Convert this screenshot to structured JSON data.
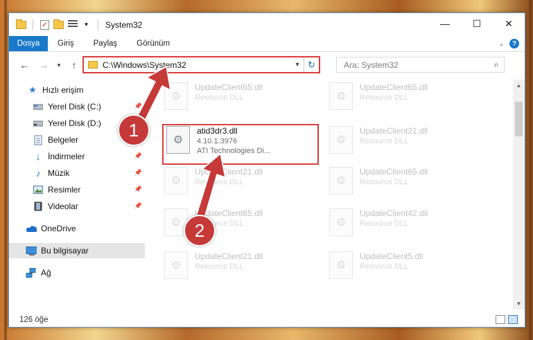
{
  "window": {
    "title": "System32",
    "controls": {
      "minimize": "—",
      "maximize": "☐",
      "close": "✕"
    }
  },
  "ribbon": {
    "tabs": [
      "Dosya",
      "Giriş",
      "Paylaş",
      "Görünüm"
    ],
    "help": "?"
  },
  "address": {
    "path": "C:\\Windows\\System32",
    "search_placeholder": "Ara: System32"
  },
  "nav": {
    "items": [
      {
        "label": "Hızlı erişim",
        "icon": "star-icon",
        "pinned": false
      },
      {
        "label": "Yerel Disk (C:)",
        "icon": "drive-c-icon",
        "pinned": true
      },
      {
        "label": "Yerel Disk (D:)",
        "icon": "drive-d-icon",
        "pinned": true
      },
      {
        "label": "Belgeler",
        "icon": "documents-icon",
        "pinned": true
      },
      {
        "label": "İndirmeler",
        "icon": "downloads-icon",
        "pinned": true
      },
      {
        "label": "Müzik",
        "icon": "music-icon",
        "pinned": true
      },
      {
        "label": "Resimler",
        "icon": "pictures-icon",
        "pinned": true
      },
      {
        "label": "Videolar",
        "icon": "videos-icon",
        "pinned": true
      },
      {
        "label": "OneDrive",
        "icon": "onedrive-icon",
        "pinned": false
      },
      {
        "label": "Bu bilgisayar",
        "icon": "this-pc-icon",
        "pinned": false
      },
      {
        "label": "Ağ",
        "icon": "network-icon",
        "pinned": false
      }
    ]
  },
  "files": {
    "highlighted": {
      "name": "atid3dr3.dll",
      "version": "4.10.1.3976",
      "company": "ATI Technologies Di..."
    },
    "faded": [
      {
        "name": "UpdateClient65.dll",
        "type": "Resource DLL"
      },
      {
        "name": "UpdateClient65.dll",
        "type": "Resource DLL"
      },
      {
        "name": "UpdateClient21.dll",
        "type": "Resource DLL"
      },
      {
        "name": "UpdateClient21.dll",
        "type": "Resource DLL"
      },
      {
        "name": "UpdateClient65.dll",
        "type": "Resource DLL"
      },
      {
        "name": "UpdateClient65.dll",
        "type": "Resource DLL"
      },
      {
        "name": "UpdateClient42.dll",
        "type": "Resource DLL"
      },
      {
        "name": "UpdateClient21.dll",
        "type": "Resource DLL"
      },
      {
        "name": "UpdateClient5.dll",
        "type": "Resource DLL"
      }
    ]
  },
  "status": {
    "count": "126 öğe"
  },
  "annotations": {
    "badge_1": "1",
    "badge_2": "2"
  },
  "colors": {
    "accent": "#1979ca",
    "highlight": "#d83d3d",
    "badge": "#c63939"
  }
}
